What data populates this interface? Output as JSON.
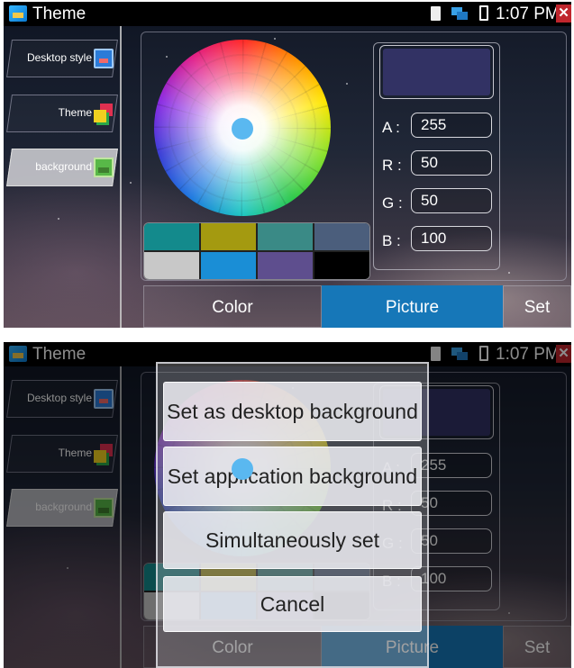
{
  "status_bar": {
    "title": "Theme",
    "time": "1:07 PM"
  },
  "sidebar": {
    "items": [
      {
        "label": "Desktop style"
      },
      {
        "label": "Theme"
      },
      {
        "label": "background"
      }
    ]
  },
  "color_panel": {
    "preview_color": "#323264",
    "fields": [
      {
        "label": "A :",
        "value": "255"
      },
      {
        "label": "R :",
        "value": "50"
      },
      {
        "label": "G :",
        "value": "50"
      },
      {
        "label": "B :",
        "value": "100"
      }
    ],
    "swatches": [
      "#138a8c",
      "#a49a10",
      "#3a8a86",
      "#4b5e7c",
      "#c8c8c8",
      "#1a8ed6",
      "#5e4e8e",
      "#000000"
    ]
  },
  "tabs": [
    {
      "label": "Color"
    },
    {
      "label": "Picture"
    },
    {
      "label": "Set"
    }
  ],
  "dialog": {
    "options": [
      {
        "label": "Set as desktop background"
      },
      {
        "label": "Set application background"
      },
      {
        "label": "Simultaneously set"
      },
      {
        "label": "Cancel"
      }
    ]
  }
}
